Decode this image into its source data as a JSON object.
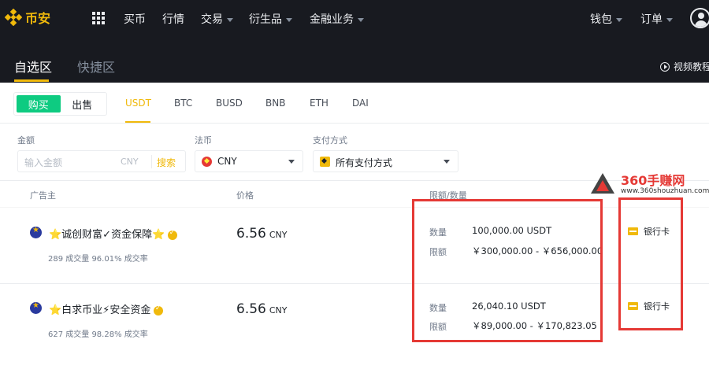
{
  "brand": {
    "name": "币安",
    "accent": "#f0b90b"
  },
  "topnav": {
    "items": [
      {
        "label": "买币"
      },
      {
        "label": "行情"
      },
      {
        "label": "交易"
      },
      {
        "label": "衍生品"
      },
      {
        "label": "金融业务"
      }
    ],
    "wallet": "钱包",
    "orders": "订单"
  },
  "subheader": {
    "tabs": [
      {
        "label": "自选区"
      },
      {
        "label": "快捷区"
      }
    ],
    "video_link": "视频教程"
  },
  "trade_side": {
    "buy": "购买",
    "sell": "出售"
  },
  "coins": [
    "USDT",
    "BTC",
    "BUSD",
    "BNB",
    "ETH",
    "DAI"
  ],
  "filters": {
    "amount_label": "金额",
    "amount_placeholder": "输入金额",
    "amount_currency": "CNY",
    "search_button": "搜索",
    "fiat_label": "法币",
    "fiat_value": "CNY",
    "payment_label": "支付方式",
    "payment_value": "所有支付方式"
  },
  "table": {
    "headers": {
      "advertiser": "广告主",
      "price": "价格",
      "limit": "限额/数量"
    },
    "rows": [
      {
        "name": "⭐诚创财富✓资金保障⭐",
        "stats": "289 成交量   96.01% 成交率",
        "price": "6.56",
        "currency": "CNY",
        "qty_label": "数量",
        "qty": "100,000.00 USDT",
        "limit_label": "限额",
        "limit": "￥300,000.00 - ￥656,000.00",
        "payment": "银行卡"
      },
      {
        "name": "⭐白求币业⚡安全资金",
        "stats": "627 成交量   98.28% 成交率",
        "price": "6.56",
        "currency": "CNY",
        "qty_label": "数量",
        "qty": "26,040.10 USDT",
        "limit_label": "限额",
        "limit": "￥89,000.00 - ￥170,823.05",
        "payment": "银行卡"
      }
    ]
  },
  "watermark": {
    "title": "360手赚网",
    "url": "www.360shouzhuan.com"
  }
}
